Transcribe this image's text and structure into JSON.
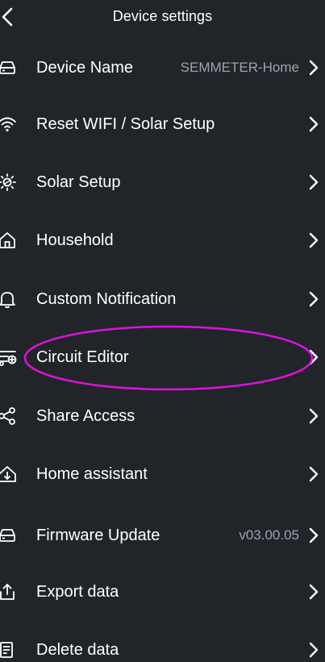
{
  "header": {
    "title": "Device settings",
    "back_icon": "chevron-left-icon"
  },
  "rows": [
    {
      "label": "Device Name",
      "value": "SEMMETER-Home",
      "icon": "router-icon"
    },
    {
      "label": "Reset WIFI / Solar Setup",
      "value": "",
      "icon": "wifi-icon"
    },
    {
      "label": "Solar Setup",
      "value": "",
      "icon": "sun-icon"
    },
    {
      "label": "Household",
      "value": "",
      "icon": "home-icon"
    },
    {
      "label": "Custom Notification",
      "value": "",
      "icon": "bell-icon"
    },
    {
      "label": "Circuit Editor",
      "value": "",
      "icon": "circuit-icon"
    },
    {
      "label": "Share Access",
      "value": "",
      "icon": "share-icon"
    },
    {
      "label": "Home assistant",
      "value": "",
      "icon": "home-download-icon"
    },
    {
      "label": "Firmware Update",
      "value": "v03.00.05",
      "icon": "router-icon"
    },
    {
      "label": "Export data",
      "value": "",
      "icon": "export-icon"
    },
    {
      "label": "Delete data",
      "value": "",
      "icon": "document-delete-icon"
    }
  ],
  "annotation": {
    "highlighted_item": "Circuit Editor",
    "color": "#e010e0"
  },
  "colors": {
    "background": "#212529",
    "text": "#ffffff",
    "secondary_text": "#9aa3ad"
  }
}
